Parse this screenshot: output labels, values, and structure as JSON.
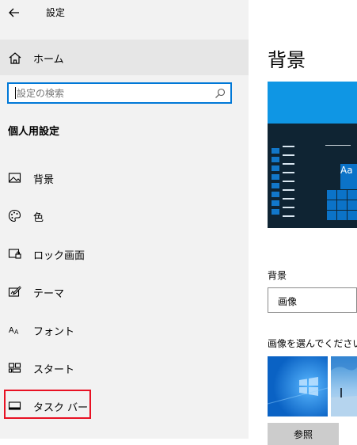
{
  "window": {
    "title": "設定"
  },
  "sidebar": {
    "home_label": "ホーム",
    "search": {
      "placeholder": "設定の検索"
    },
    "section_title": "個人用設定",
    "items": [
      {
        "label": "背景",
        "icon": "picture-icon"
      },
      {
        "label": "色",
        "icon": "palette-icon"
      },
      {
        "label": "ロック画面",
        "icon": "lock-screen-icon"
      },
      {
        "label": "テーマ",
        "icon": "theme-brush-icon"
      },
      {
        "label": "フォント",
        "icon": "font-icon"
      },
      {
        "label": "スタート",
        "icon": "start-tiles-icon"
      },
      {
        "label": "タスク バー",
        "icon": "taskbar-icon"
      }
    ],
    "highlight_color": "#e81123"
  },
  "main": {
    "title": "背景",
    "preview_sample_text": "Aa",
    "background_label": "背景",
    "background_value": "画像",
    "choose_label": "画像を選んでください",
    "browse_label": "参照"
  },
  "colors": {
    "accent": "#0078d7",
    "sidebar_bg": "#f2f2f2",
    "preview_sky": "#0f96e4"
  }
}
